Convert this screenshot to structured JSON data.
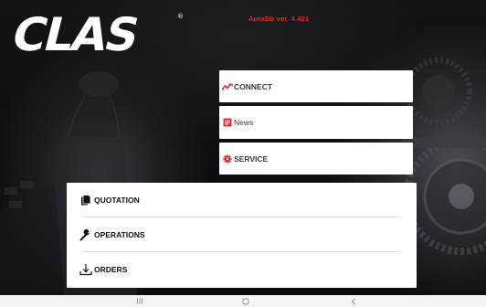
{
  "app": {
    "logo_text": "CLAS",
    "logo_mark": "®",
    "version": "AutoDb ver. 4.421"
  },
  "top_menu": [
    {
      "label": "CONNECT",
      "icon": "trend-line-icon",
      "icon_color": "#e8262b"
    },
    {
      "label": "News",
      "icon": "news-icon",
      "icon_color": "#e8262b"
    },
    {
      "label": "SERVICE",
      "icon": "gear-icon",
      "icon_color": "#e8262b"
    }
  ],
  "main_menu": [
    {
      "label": "QUOTATION",
      "icon": "document-icon"
    },
    {
      "label": "OPERATIONS",
      "icon": "wrench-icon"
    },
    {
      "label": "ORDERS",
      "icon": "download-icon"
    }
  ],
  "system_nav": {
    "recents": "recents-icon",
    "home": "home-icon",
    "back": "back-icon"
  },
  "colors": {
    "accent": "#e8262b",
    "background": "#0d0e10",
    "card": "#ffffff"
  }
}
